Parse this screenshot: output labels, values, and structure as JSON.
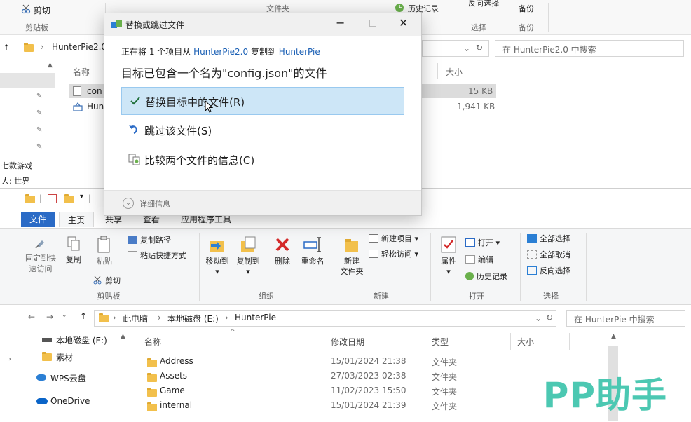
{
  "bg_window": {
    "ribbon": {
      "cut_label": "剪切",
      "clipboard_group": "剪贴板",
      "folder_group": "文件夹",
      "history_label": "历史记录",
      "invert_label": "反向选择",
      "select_group": "选择",
      "backup_top": "备份",
      "backup_group": "备份"
    },
    "address": {
      "path_segment": "HunterPie2.0",
      "search_placeholder": "在 HunterPie2.0 中搜索"
    },
    "left_labels": [
      "七款游戏",
      "人: 世界"
    ],
    "list": {
      "col_name": "名称",
      "col_size": "大小",
      "rows": [
        {
          "name": "con",
          "size": "15 KB"
        },
        {
          "name": "Hun",
          "size": "1,941 KB"
        }
      ]
    }
  },
  "dialog": {
    "title": "替换或跳过文件",
    "progress_prefix": "正在将 1 个项目从",
    "source": "HunterPie2.0",
    "copy_to": "复制到",
    "dest": "HunterPie",
    "heading": "目标已包含一个名为\"config.json\"的文件",
    "options": [
      {
        "label": "替换目标中的文件(R)",
        "icon": "check-icon"
      },
      {
        "label": "跳过该文件(S)",
        "icon": "skip-icon"
      },
      {
        "label": "比较两个文件的信息(C)",
        "icon": "compare-icon"
      }
    ],
    "details_label": "详细信息"
  },
  "front_window": {
    "tabs": [
      "文件",
      "主页",
      "共享",
      "查看",
      "应用程序工具"
    ],
    "ribbon": {
      "pin_label_1": "固定到快",
      "pin_label_2": "速访问",
      "copy_label": "复制",
      "paste_label": "粘贴",
      "copy_path_label": "复制路径",
      "paste_shortcut_label": "粘贴快捷方式",
      "cut_label": "剪切",
      "clipboard_group": "剪贴板",
      "move_to_label": "移动到",
      "copy_to_label": "复制到",
      "delete_label": "删除",
      "rename_label": "重命名",
      "organize_group": "组织",
      "new_folder_label_1": "新建",
      "new_folder_label_2": "文件夹",
      "new_item_label": "新建项目",
      "easy_access_label": "轻松访问",
      "new_group": "新建",
      "properties_label": "属性",
      "open_label": "打开",
      "edit_label": "编辑",
      "history_label": "历史记录",
      "open_group": "打开",
      "select_all_label": "全部选择",
      "select_none_label": "全部取消",
      "invert_label": "反向选择",
      "select_group": "选择"
    },
    "address": {
      "segments": [
        "此电脑",
        "本地磁盘 (E:)",
        "HunterPie"
      ],
      "search_placeholder": "在 HunterPie 中搜索"
    },
    "nav": [
      {
        "label": "本地磁盘 (E:)",
        "icon": "drive-icon"
      },
      {
        "label": "素材",
        "icon": "folder-icon"
      },
      {
        "label": "WPS云盘",
        "icon": "cloud-icon"
      },
      {
        "label": "OneDrive",
        "icon": "onedrive-icon"
      }
    ],
    "list": {
      "col_name": "名称",
      "col_date": "修改日期",
      "col_type": "类型",
      "col_size": "大小",
      "rows": [
        {
          "name": "Address",
          "date": "15/01/2024 21:38",
          "type": "文件夹"
        },
        {
          "name": "Assets",
          "date": "27/03/2023 02:38",
          "type": "文件夹"
        },
        {
          "name": "Game",
          "date": "11/02/2023 15:50",
          "type": "文件夹"
        },
        {
          "name": "internal",
          "date": "15/01/2024 21:39",
          "type": "文件夹"
        }
      ]
    }
  },
  "watermark": "PP助手",
  "colors": {
    "accent": "#2b6bc6",
    "selection": "#cde6f7",
    "watermark": "#4cc8b2",
    "link": "#1a5fb4"
  }
}
